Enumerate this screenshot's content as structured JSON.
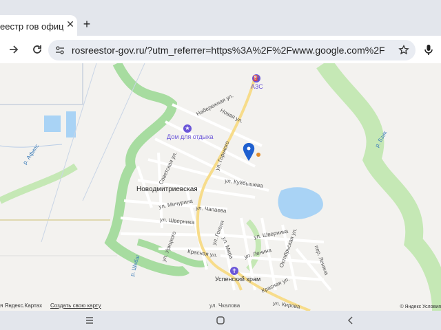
{
  "tab": {
    "title": "еестр гов офиц",
    "close_icon": "close-icon"
  },
  "new_tab_icon": "plus-icon",
  "toolbar": {
    "url": "rosreestor-gov.ru/?utm_referrer=https%3A%2F%2Fwww.google.com%2F",
    "icons": [
      "forward-icon",
      "reload-icon",
      "site-settings-icon",
      "star-icon",
      "microphone-icon"
    ]
  },
  "map": {
    "town": "Новодмитриевская",
    "pois": {
      "gas": "АЗС",
      "rest": "Дом для отдыха",
      "church": "Успенский храм"
    },
    "streets": {
      "naberezhnaya": "Набережная ул.",
      "novaya": "Новая ул.",
      "gorkogo": "ул. Горького",
      "sovetskaya": "Советская ул.",
      "kuybysheva": "ул. Куйбышева",
      "michurina": "ул. Мичурина",
      "chapaeva": "ул. Чапаева",
      "shvernika1": "ул. Шверника",
      "shvernika2": "ул. Шверника",
      "oktyabrskaya": "Октябрьская ул.",
      "pervyi_lenina": "пер. Ленина",
      "lenina": "ул. Ленина",
      "gogolya": "ул. Гоголя",
      "mira": "ул. Мира",
      "krasnaya1": "Красная ул.",
      "krasnaya2": "Красная ул.",
      "kirova": "ул. Кирова",
      "chkalova": "ул. Чкалова",
      "uritskogo": "ул. Урицкого"
    },
    "rivers": {
      "afips": "р. Афипс",
      "shebsh": "р. Шебш",
      "bzhik": "р. Бзик"
    },
    "footer": {
      "left": "я Яндекс.Картах",
      "link": "Создать свою карту",
      "right": "© Яндекс Условия"
    }
  },
  "colors": {
    "water": "#a9d3f5",
    "green": "#c5e8b5",
    "river_bank": "#a7dca0",
    "road_yellow": "#f7dc8a",
    "poi": "#6b56d8",
    "pin": "#1e5fcf"
  }
}
